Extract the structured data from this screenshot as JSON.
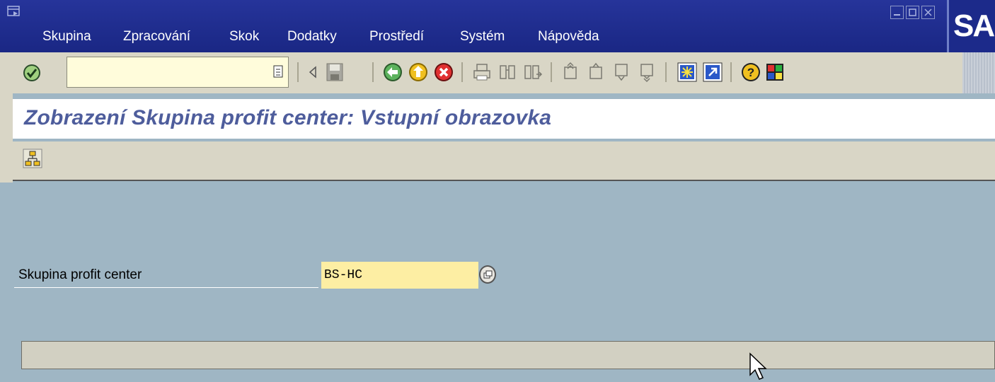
{
  "menu": {
    "items": [
      {
        "label": "Skupina"
      },
      {
        "label": "Zpracování"
      },
      {
        "label": "Skok"
      },
      {
        "label": "Dodatky"
      },
      {
        "label": "Prostředí"
      },
      {
        "label": "Systém"
      },
      {
        "label": "Nápověda"
      }
    ],
    "logo_text": "SAP"
  },
  "toolbar": {
    "command_field_value": "",
    "icons": [
      "enter-icon",
      "back-triangle-icon",
      "save-icon",
      "back-icon",
      "exit-icon",
      "cancel-icon",
      "print-icon",
      "find-icon",
      "find-next-icon",
      "first-page-icon",
      "previous-page-icon",
      "next-page-icon",
      "last-page-icon",
      "create-session-icon",
      "shortcut-icon",
      "help-icon",
      "customize-layout-icon"
    ]
  },
  "title": "Zobrazení Skupina profit center: Vstupní obrazovka",
  "app_toolbar": {
    "icons": [
      "hierarchy-icon"
    ]
  },
  "form": {
    "label": "Skupina profit center",
    "value": "BS-HC"
  },
  "status_bar": {
    "text": ""
  },
  "colors": {
    "menubar": "#1c2a8a",
    "toolbar": "#d9d6c6",
    "workarea": "#9fb6c4",
    "input_required": "#fdeea3",
    "title_text": "#4e5d9c"
  }
}
